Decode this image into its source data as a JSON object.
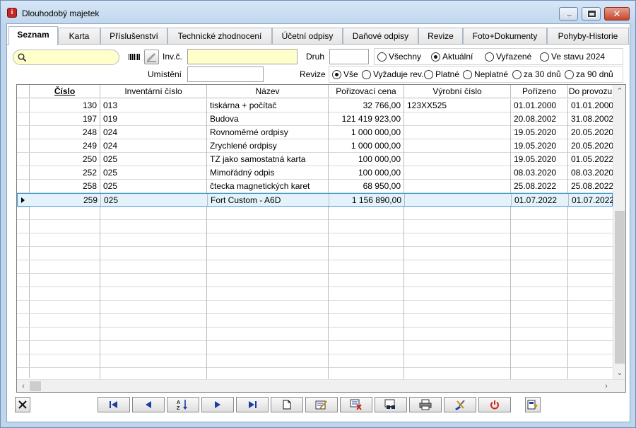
{
  "window": {
    "title": "Dlouhodobý majetek"
  },
  "tabs": [
    {
      "label": "Seznam",
      "active": true
    },
    {
      "label": "Karta"
    },
    {
      "label": "Příslušenství"
    },
    {
      "label": "Technické zhodnocení"
    },
    {
      "label": "Účetní odpisy"
    },
    {
      "label": "Daňové odpisy"
    },
    {
      "label": "Revize"
    },
    {
      "label": "Foto+Dokumenty"
    },
    {
      "label": "Pohyby-Historie"
    }
  ],
  "filters": {
    "search_value": "",
    "inv_label": "Inv.č.",
    "inv_value": "",
    "location_label": "Umístění",
    "location_value": "",
    "type_label": "Druh",
    "type_value": "",
    "state_options": [
      {
        "label": "Všechny",
        "selected": false
      },
      {
        "label": "Aktuální",
        "selected": true
      },
      {
        "label": "Vyřazené",
        "selected": false
      },
      {
        "label": "Ve stavu 2024",
        "selected": false
      }
    ],
    "revision_label": "Revize",
    "revision_options": [
      {
        "label": "Vše",
        "selected": true
      },
      {
        "label": "Vyžaduje rev.",
        "selected": false
      },
      {
        "label": "Platné",
        "selected": false
      },
      {
        "label": "Neplatné",
        "selected": false
      },
      {
        "label": "za 30 dnů",
        "selected": false
      },
      {
        "label": "za 90 dnů",
        "selected": false
      }
    ]
  },
  "table": {
    "columns": [
      "Číslo",
      "Inventární číslo",
      "Název",
      "Pořizovací cena",
      "Výrobní číslo",
      "Pořízeno",
      "Do provozu"
    ],
    "sorted_column": 0,
    "selected_row": 7,
    "rows": [
      [
        "130",
        "013",
        "tiskárna + počítač",
        "32 766,00",
        "123XX525",
        "01.01.2000",
        "01.01.2000"
      ],
      [
        "197",
        "019",
        "Budova",
        "121 419 923,00",
        "",
        "20.08.2002",
        "31.08.2002"
      ],
      [
        "248",
        "024",
        "Rovnoměrné ordpisy",
        "1 000 000,00",
        "",
        "19.05.2020",
        "20.05.2020"
      ],
      [
        "249",
        "024",
        "Zrychlené ordpisy",
        "1 000 000,00",
        "",
        "19.05.2020",
        "20.05.2020"
      ],
      [
        "250",
        "025",
        "TZ jako samostatná karta",
        "100 000,00",
        "",
        "19.05.2020",
        "01.05.2022"
      ],
      [
        "252",
        "025",
        "Mimořádný odpis",
        "100 000,00",
        "",
        "08.03.2020",
        "08.03.2020"
      ],
      [
        "258",
        "025",
        "čtecka magnetických karet",
        "68 950,00",
        "",
        "25.08.2022",
        "25.08.2022"
      ],
      [
        "259",
        "025",
        "Fort Custom - A6D",
        "1 156 890,00",
        "",
        "01.07.2022",
        "01.07.2022"
      ]
    ]
  },
  "toolbar": {
    "icons": [
      "close-filter-icon",
      "first-record-icon",
      "previous-record-icon",
      "sort-az-icon",
      "next-record-icon",
      "last-record-icon",
      "new-record-icon",
      "edit-record-icon",
      "delete-record-icon",
      "search-record-icon",
      "print-icon",
      "tools-icon",
      "power-icon",
      "export-icon"
    ]
  },
  "colors": {
    "selected_row_bg": "#e4f3fb",
    "selected_row_border": "#3c9dd6",
    "input_yellow": "#ffffcc",
    "nav_blue": "#1a3ea8",
    "power_red": "#d0211b"
  }
}
